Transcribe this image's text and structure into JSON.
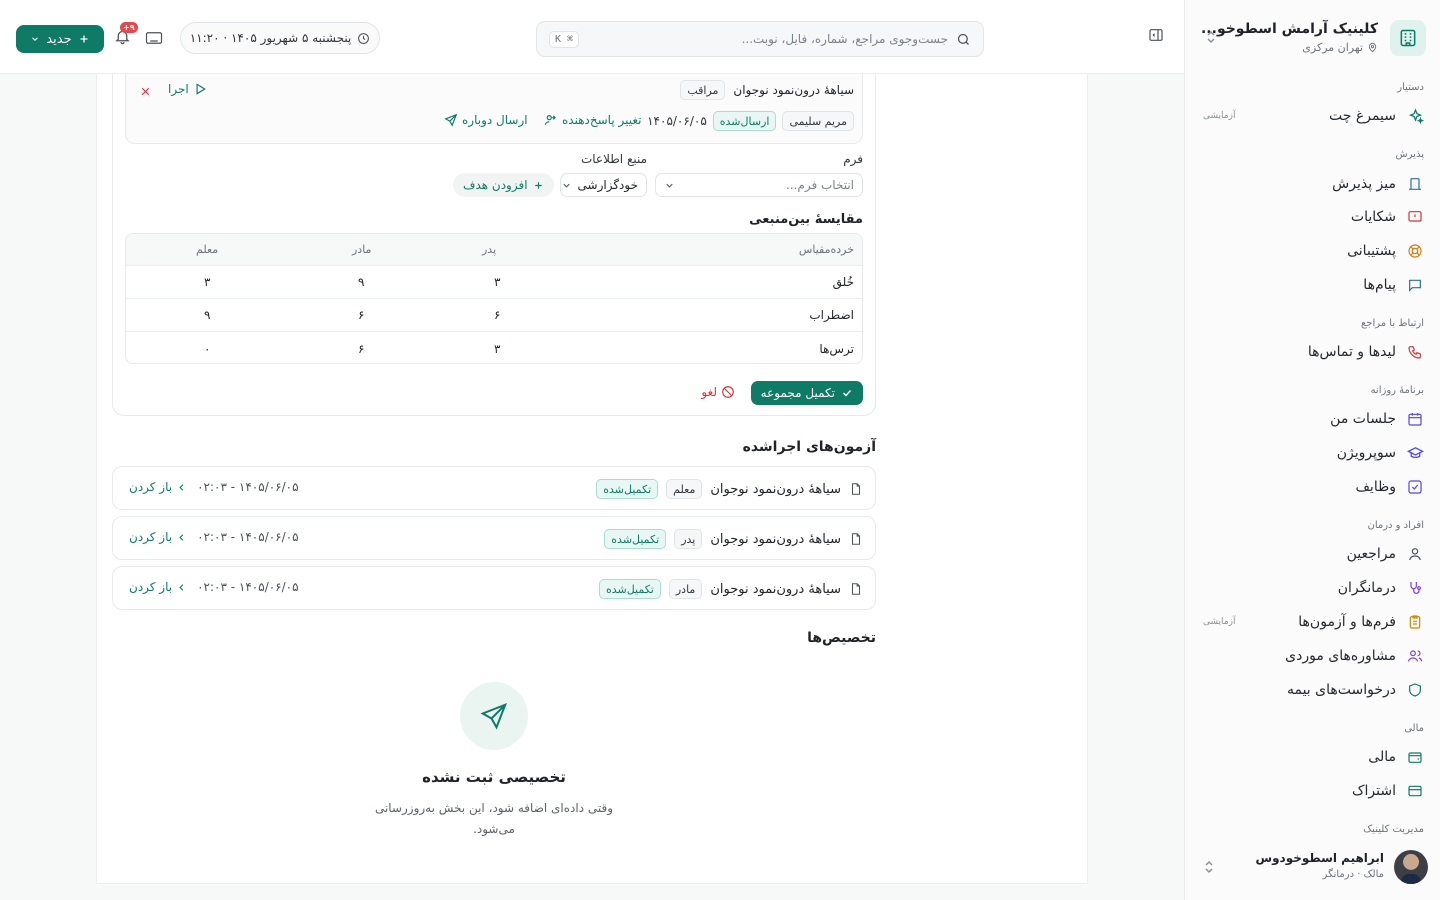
{
  "clinic": {
    "name": "کلینیک آرامش اسطوخو...",
    "location": "تهران مرکزی"
  },
  "sidebar": {
    "groups": [
      {
        "title": "دستیار",
        "items": [
          {
            "label": "سیمرغ چت",
            "badge": "آزمایشی",
            "icon": "sparkles-icon"
          }
        ]
      },
      {
        "title": "پذیرش",
        "items": [
          {
            "label": "میز پذیرش",
            "icon": "desk-icon"
          },
          {
            "label": "شکایات",
            "icon": "complaint-icon"
          },
          {
            "label": "پشتیبانی",
            "icon": "lifebuoy-icon"
          },
          {
            "label": "پیام‌ها",
            "icon": "message-icon"
          }
        ]
      },
      {
        "title": "ارتباط با مراجع",
        "items": [
          {
            "label": "لیدها و تماس‌ها",
            "icon": "phone-icon"
          }
        ]
      },
      {
        "title": "برنامهٔ روزانه",
        "items": [
          {
            "label": "جلسات من",
            "icon": "calendar-icon"
          },
          {
            "label": "سوپرویژن",
            "icon": "graduation-cap-icon"
          },
          {
            "label": "وظایف",
            "icon": "checkbox-icon"
          }
        ]
      },
      {
        "title": "افراد و درمان",
        "items": [
          {
            "label": "مراجعین",
            "icon": "user-icon"
          },
          {
            "label": "درمانگران",
            "icon": "stethoscope-icon"
          },
          {
            "label": "فرم‌ها و آزمون‌ها",
            "badge": "آزمایشی",
            "icon": "clipboard-icon"
          },
          {
            "label": "مشاوره‌های موردی",
            "icon": "users-icon"
          },
          {
            "label": "درخواست‌های بیمه",
            "icon": "shield-icon"
          }
        ]
      },
      {
        "title": "مالی",
        "items": [
          {
            "label": "مالی",
            "icon": "wallet-icon"
          },
          {
            "label": "اشتراک",
            "icon": "credit-card-icon"
          }
        ]
      },
      {
        "title": "مدیریت کلینیک",
        "items": []
      }
    ],
    "user": {
      "name": "ابراهیم اسطوخودوس",
      "role": "مالک · درمانگر"
    }
  },
  "header": {
    "search_placeholder": "جست‌وجوی مراجع، شماره، فایل، نوبت...",
    "search_shortcut": "⌘ K",
    "datetime": "پنجشنبه ۵ شهریور ۱۴۰۵ · ۱۱:۲۰",
    "notifications_badge": "۹+",
    "new_button": "جدید"
  },
  "assignment": {
    "test_name": "سیاههٔ درون‌نمود نوجوان",
    "role_tag": "مراقب",
    "run_label": "اجرا",
    "respondent": "مریم سلیمی",
    "status": "ارسال‌شده",
    "date": "۱۴۰۵/۰۶/۰۵",
    "change_respondent": "تغییر پاسخ‌دهنده",
    "resend": "ارسال دوباره"
  },
  "form_section": {
    "form_label": "فرم",
    "form_placeholder": "انتخاب فرم...",
    "source_label": "منبع اطلاعات",
    "source_value": "خودگزارشی",
    "add_goal": "افزودن هدف"
  },
  "comparison": {
    "title": "مقایسهٔ بین‌منبعی",
    "headers": [
      "خرده‌مقیاس",
      "پدر",
      "مادر",
      "معلم"
    ],
    "rows": [
      [
        "خُلق",
        "۳",
        "۹",
        "۳"
      ],
      [
        "اضطراب",
        "۶",
        "۶",
        "۹"
      ],
      [
        "ترس‌ها",
        "۳",
        "۶",
        "۰"
      ]
    ]
  },
  "actions": {
    "complete": "تکمیل مجموعه",
    "cancel": "لغو"
  },
  "completed_tests": {
    "title": "آزمون‌های اجراشده",
    "items": [
      {
        "name": "سیاههٔ درون‌نمود نوجوان",
        "role": "معلم",
        "status": "تکمیل‌شده",
        "datetime": "۱۴۰۵/۰۶/۰۵ - ۰۲:۰۳",
        "open": "باز کردن"
      },
      {
        "name": "سیاههٔ درون‌نمود نوجوان",
        "role": "پدر",
        "status": "تکمیل‌شده",
        "datetime": "۱۴۰۵/۰۶/۰۵ - ۰۲:۰۳",
        "open": "باز کردن"
      },
      {
        "name": "سیاههٔ درون‌نمود نوجوان",
        "role": "مادر",
        "status": "تکمیل‌شده",
        "datetime": "۱۴۰۵/۰۶/۰۵ - ۰۲:۰۳",
        "open": "باز کردن"
      }
    ]
  },
  "assignments_section": {
    "title": "تخصیص‌ها",
    "empty_title": "تخصیصی ثبت نشده",
    "empty_desc": "وقتی داده‌ای اضافه شود، این بخش به‌روزرسانی می‌شود."
  },
  "colors": {
    "accent": "#0f7a66",
    "danger": "#d1343a",
    "badge": "#e5484d"
  }
}
